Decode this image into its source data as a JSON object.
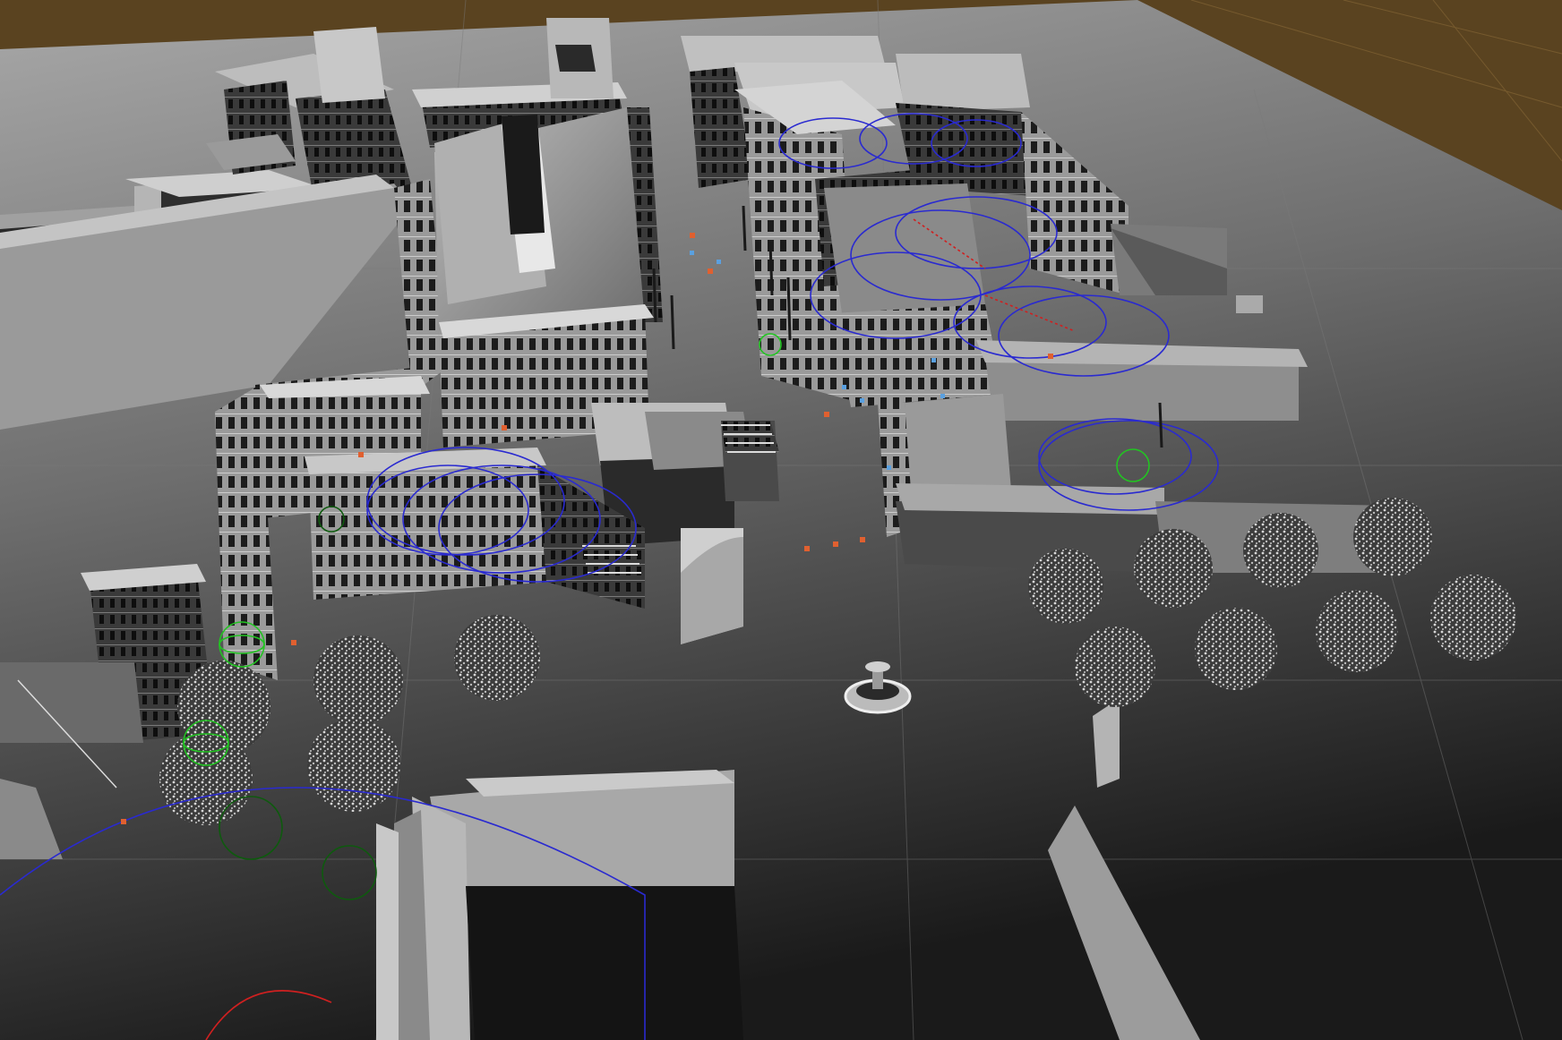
{
  "viewport": {
    "kind": "3d-scene-view",
    "colors": {
      "background_ground": "#5a4320",
      "plane_light": "#9a9a9a",
      "plane_dark": "#1e1e1e",
      "building_light": "#b8b8b8",
      "building_mid": "#7a7a7a",
      "building_dark": "#2e2e2e",
      "light_gizmo_blue": "#2a2ad0",
      "light_gizmo_green": "#22c422",
      "light_gizmo_red": "#d02020",
      "marker_orange": "#e06030",
      "tree_foliage": "#8c8c8c",
      "grid_line": "#6a6a6a"
    },
    "icons": [
      "point-light-gizmo-icon",
      "reflection-probe-gizmo-icon",
      "camera-gizmo-icon",
      "fountain-model-icon",
      "tree-model-icon"
    ]
  }
}
